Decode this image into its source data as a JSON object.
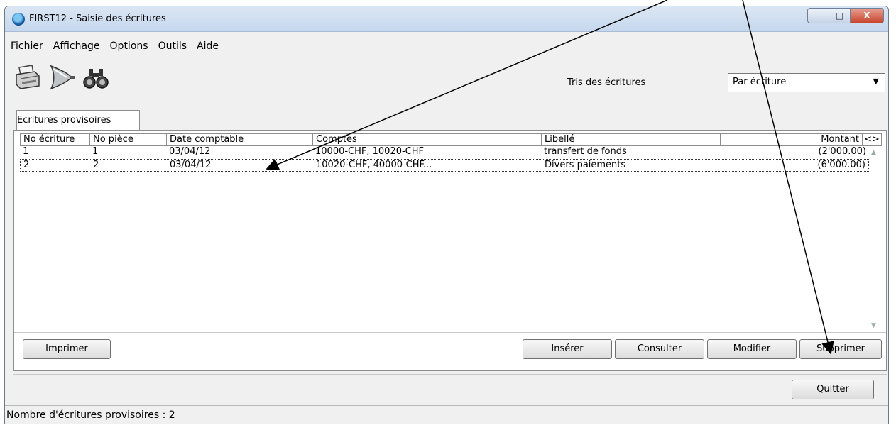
{
  "window": {
    "title": "FIRST12 - Saisie des écritures",
    "minimize": "–",
    "maximize": "□",
    "close": "X"
  },
  "menu": [
    "Fichier",
    "Affichage",
    "Options",
    "Outils",
    "Aide"
  ],
  "toolbar": {
    "icons": [
      "printer-icon",
      "funnel-filter-icon",
      "binoculars-icon"
    ]
  },
  "sort": {
    "label": "Tris des écritures",
    "value": "Par écriture",
    "caret": "▼"
  },
  "tab": {
    "label": "Ecritures provisoires"
  },
  "table": {
    "columns": [
      "No écriture",
      "No pièce",
      "Date comptable",
      "Comptes",
      "Libellé",
      "",
      "Montant",
      "<>"
    ],
    "rows": [
      {
        "no": "1",
        "piece": "1",
        "date": "03/04/12",
        "comptes": "10000-CHF, 10020-CHF",
        "libelle": "transfert de fonds",
        "montant": "(2'000.00)"
      },
      {
        "no": "2",
        "piece": "2",
        "date": "03/04/12",
        "comptes": "10020-CHF, 40000-CHF...",
        "libelle": "Divers paiements",
        "montant": "(6'000.00)"
      }
    ]
  },
  "buttons": {
    "imprimer": "Imprimer",
    "inserer": "Insérer",
    "consulter": "Consulter",
    "modifier": "Modifier",
    "supprimer": "Supprimer",
    "quitter": "Quitter"
  },
  "status": {
    "text": "Nombre d'écritures provisoires : 2"
  }
}
